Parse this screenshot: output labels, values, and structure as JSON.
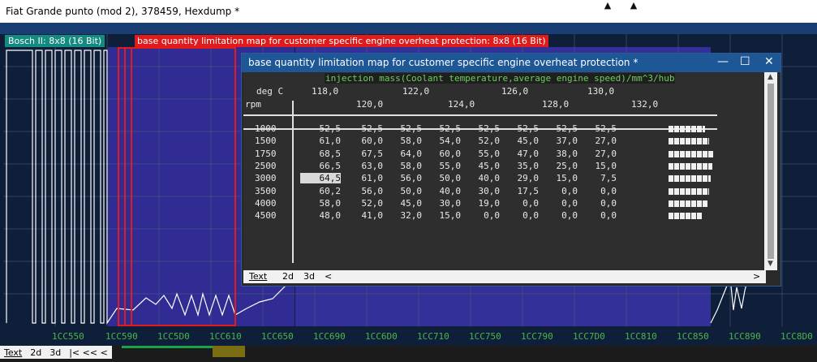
{
  "window": {
    "title": "Fiat Grande punto (mod 2), 378459, Hexdump *"
  },
  "maps": {
    "bosch_label": "Bosch II: 8x8 (16 Bit)",
    "map_label": "base quantity limitation map for customer specific engine overheat protection: 8x8 (16 Bit)"
  },
  "address_ticks": [
    "1CC550",
    "1CC590",
    "1CC5D0",
    "1CC610",
    "1CC650",
    "1CC690",
    "1CC6D0",
    "1CC710",
    "1CC750",
    "1CC790",
    "1CC7D0",
    "1CC810",
    "1CC850",
    "1CC890",
    "1CC8D0"
  ],
  "bottom_tabs": {
    "text": "Text",
    "d2": "2d",
    "d3": "3d",
    "nav": "|< << <"
  },
  "dialog": {
    "title": "base quantity limitation map for customer specific engine overheat protection *",
    "data_label": "injection mass(Coolant temperature,average engine speed)/mm^3/hub",
    "unit_x": "deg C",
    "unit_y": "rpm",
    "x_axis_row1": [
      "118,0",
      "122,0",
      "126,0",
      "130,0"
    ],
    "x_axis_row2": [
      "120,0",
      "124,0",
      "128,0",
      "132,0"
    ],
    "rows": [
      {
        "rpm": "1000",
        "values": [
          "52,5",
          "52,5",
          "52,5",
          "52,5",
          "52,5",
          "52,5",
          "52,5",
          "52,5"
        ]
      },
      {
        "rpm": "1500",
        "values": [
          "61,0",
          "60,0",
          "58,0",
          "54,0",
          "52,0",
          "45,0",
          "37,0",
          "27,0"
        ]
      },
      {
        "rpm": "1750",
        "values": [
          "68,5",
          "67,5",
          "64,0",
          "60,0",
          "55,0",
          "47,0",
          "38,0",
          "27,0"
        ]
      },
      {
        "rpm": "2500",
        "values": [
          "66,5",
          "63,0",
          "58,0",
          "55,0",
          "45,0",
          "35,0",
          "25,0",
          "15,0"
        ]
      },
      {
        "rpm": "3000",
        "values": [
          "64,5",
          "61,0",
          "56,0",
          "50,0",
          "40,0",
          "29,0",
          "15,0",
          "7,5"
        ]
      },
      {
        "rpm": "3500",
        "values": [
          "60,2",
          "56,0",
          "50,0",
          "40,0",
          "30,0",
          "17,5",
          "0,0",
          "0,0"
        ]
      },
      {
        "rpm": "4000",
        "values": [
          "58,0",
          "52,0",
          "45,0",
          "30,0",
          "19,0",
          "0,0",
          "0,0",
          "0,0"
        ]
      },
      {
        "rpm": "4500",
        "values": [
          "48,0",
          "41,0",
          "32,0",
          "15,0",
          "0,0",
          "0,0",
          "0,0",
          "0,0"
        ]
      }
    ],
    "tabs": {
      "text": "Text",
      "d2": "2d",
      "d3": "3d"
    }
  },
  "colors": {
    "accent": "#1e5796",
    "map_red": "#e01b1b",
    "bosch_teal": "#138b80",
    "addr_green": "#49b64a"
  }
}
